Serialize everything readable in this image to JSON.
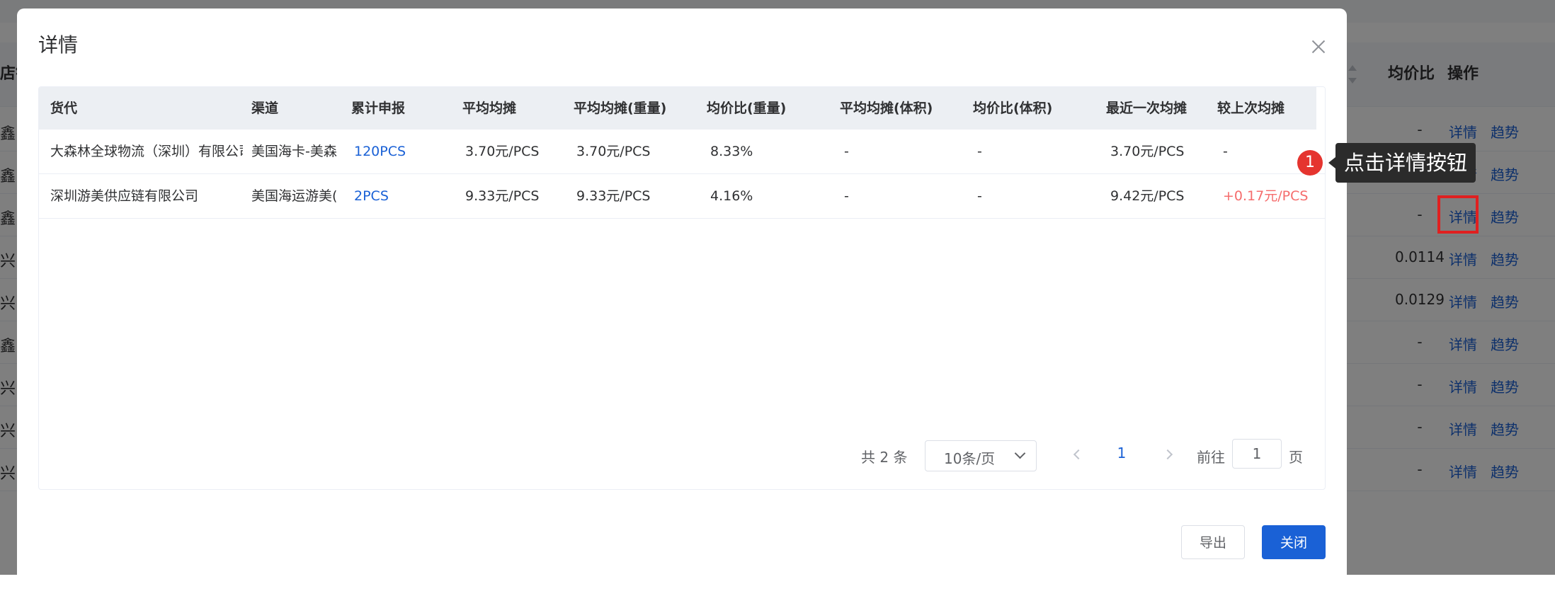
{
  "background": {
    "header": {
      "store_col": "店铺",
      "avg_ratio_col": "均价比",
      "actions_col": "操作"
    },
    "rows": [
      {
        "left_text": "鑫",
        "avg_ratio": "-",
        "detail": "详情",
        "trend": "趋势"
      },
      {
        "left_text": "鑫",
        "avg_ratio": "",
        "detail": "详情",
        "trend": "趋势"
      },
      {
        "left_text": "鑫",
        "avg_ratio": "-",
        "detail": "详情",
        "trend": "趋势"
      },
      {
        "left_text": "兴",
        "avg_ratio": "0.0114",
        "detail": "详情",
        "trend": "趋势"
      },
      {
        "left_text": "兴",
        "avg_ratio": "0.0129",
        "detail": "详情",
        "trend": "趋势"
      },
      {
        "left_text": "鑫",
        "avg_ratio": "-",
        "detail": "详情",
        "trend": "趋势"
      },
      {
        "left_text": "兴",
        "avg_ratio": "-",
        "detail": "详情",
        "trend": "趋势"
      },
      {
        "left_text": "兴",
        "avg_ratio": "-",
        "detail": "详情",
        "trend": "趋势"
      },
      {
        "left_text": "兴",
        "avg_ratio": "-",
        "detail": "详情",
        "trend": "趋势"
      }
    ]
  },
  "dialog": {
    "title": "详情",
    "columns": [
      "货代",
      "渠道",
      "累计申报",
      "平均均摊",
      "平均均摊(重量)",
      "均价比(重量)",
      "平均均摊(体积)",
      "均价比(体积)",
      "最近一次均摊",
      "较上次均摊"
    ],
    "rows": [
      [
        "大森林全球物流（深圳）有限公司",
        "美国海卡-美森",
        "120PCS",
        "3.70元/PCS",
        "3.70元/PCS",
        "8.33%",
        "-",
        "-",
        "3.70元/PCS",
        "-"
      ],
      [
        "深圳游美供应链有限公司",
        "美国海运游美(",
        "2PCS",
        "9.33元/PCS",
        "9.33元/PCS",
        "4.16%",
        "-",
        "-",
        "9.42元/PCS",
        "+0.17元/PCS"
      ]
    ],
    "pagination": {
      "total": "共 2 条",
      "page_size": "10条/页",
      "current_page": "1",
      "goto_label": "前往",
      "goto_value": "1",
      "page_suffix": "页"
    },
    "buttons": {
      "export": "导出",
      "close": "关闭"
    }
  },
  "guide": {
    "step": "1",
    "tip": "点击详情按钮"
  }
}
